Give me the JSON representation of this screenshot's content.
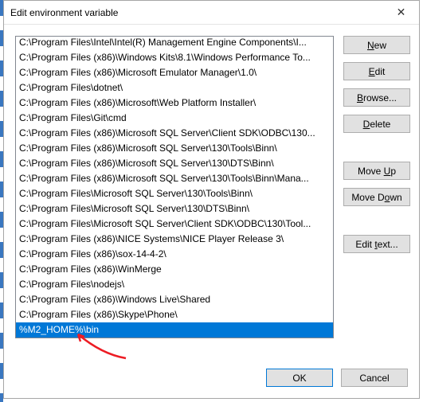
{
  "window": {
    "title": "Edit environment variable"
  },
  "list": {
    "items": [
      "C:\\Program Files\\Intel\\Intel(R) Management Engine Components\\I...",
      "C:\\Program Files (x86)\\Windows Kits\\8.1\\Windows Performance To...",
      "C:\\Program Files (x86)\\Microsoft Emulator Manager\\1.0\\",
      "C:\\Program Files\\dotnet\\",
      "C:\\Program Files (x86)\\Microsoft\\Web Platform Installer\\",
      "C:\\Program Files\\Git\\cmd",
      "C:\\Program Files (x86)\\Microsoft SQL Server\\Client SDK\\ODBC\\130...",
      "C:\\Program Files (x86)\\Microsoft SQL Server\\130\\Tools\\Binn\\",
      "C:\\Program Files (x86)\\Microsoft SQL Server\\130\\DTS\\Binn\\",
      "C:\\Program Files (x86)\\Microsoft SQL Server\\130\\Tools\\Binn\\Mana...",
      "C:\\Program Files\\Microsoft SQL Server\\130\\Tools\\Binn\\",
      "C:\\Program Files\\Microsoft SQL Server\\130\\DTS\\Binn\\",
      "C:\\Program Files\\Microsoft SQL Server\\Client SDK\\ODBC\\130\\Tool...",
      "C:\\Program Files (x86)\\NICE Systems\\NICE Player Release 3\\",
      "C:\\Program Files (x86)\\sox-14-4-2\\",
      "C:\\Program Files (x86)\\WinMerge",
      "C:\\Program Files\\nodejs\\",
      "C:\\Program Files (x86)\\Windows Live\\Shared",
      "C:\\Program Files (x86)\\Skype\\Phone\\",
      "%M2_HOME%\\bin"
    ],
    "selected_index": 19
  },
  "buttons": {
    "new": "ew",
    "new_u": "N",
    "edit": "dit",
    "edit_u": "E",
    "browse": "rowse...",
    "browse_u": "B",
    "delete": "elete",
    "delete_u": "D",
    "moveup": "Move ",
    "moveup_after": "p",
    "moveup_u": "U",
    "movedown": "Move D",
    "movedown_after": "wn",
    "movedown_u": "o",
    "edittext": "Edit ",
    "edittext_after": "ext...",
    "edittext_u": "t",
    "ok": "OK",
    "cancel": "Cancel"
  }
}
